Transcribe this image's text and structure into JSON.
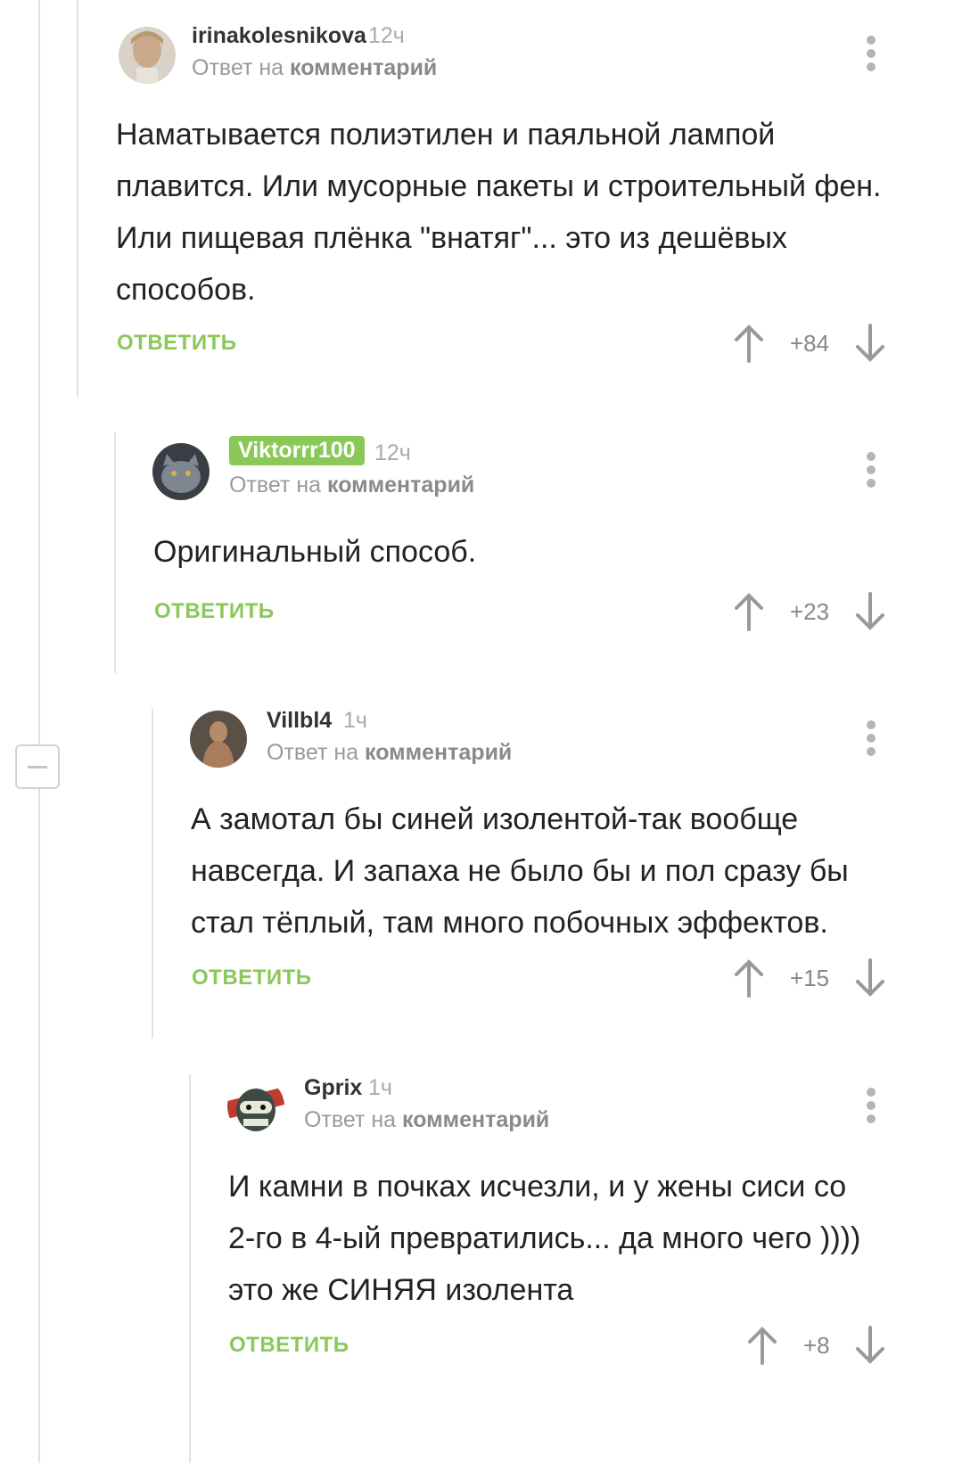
{
  "thread": {
    "collapse_label": "−",
    "comments": [
      {
        "author": "irinakolesnikova",
        "time": "12ч",
        "reply_prefix": "Ответ на",
        "reply_target": "комментарий",
        "text": "Наматывается полиэтилен и паяльной лампой плавится. Или мусорные пакеты и строительный фен. Или пищевая плёнка \"внатяг\"... это из дешёвых способов.",
        "reply_label": "ОТВЕТИТЬ",
        "score": "+84"
      },
      {
        "author": "Viktorrr100",
        "time": "12ч",
        "reply_prefix": "Ответ на",
        "reply_target": "комментарий",
        "text": "Оригинальный способ.",
        "reply_label": "ОТВЕТИТЬ",
        "score": "+23"
      },
      {
        "author": "Villbl4",
        "time": "1ч",
        "reply_prefix": "Ответ на",
        "reply_target": "комментарий",
        "text": "А замотал бы синей изолентой-так вообще навсегда. И запаха не было бы и пол сразу бы стал тёплый, там много побочных эффектов.",
        "reply_label": "ОТВЕТИТЬ",
        "score": "+15"
      },
      {
        "author": "Gprix",
        "time": "1ч",
        "reply_prefix": "Ответ на",
        "reply_target": "комментарий",
        "text": "И камни в почках исчезли, и у жены сиси со 2-го в 4-ый превратились... да много чего )))) это же СИНЯЯ изолента",
        "reply_label": "ОТВЕТИТЬ",
        "score": "+8"
      }
    ]
  },
  "colors": {
    "accent_green": "#8ac858",
    "meta_gray": "#9a9a9a",
    "tree_line": "#e2e2e2"
  },
  "icons": {
    "vote_up": "arrow-up-icon",
    "vote_down": "arrow-down-icon",
    "menu": "more-vertical-icon",
    "collapse": "minus-square-icon"
  }
}
